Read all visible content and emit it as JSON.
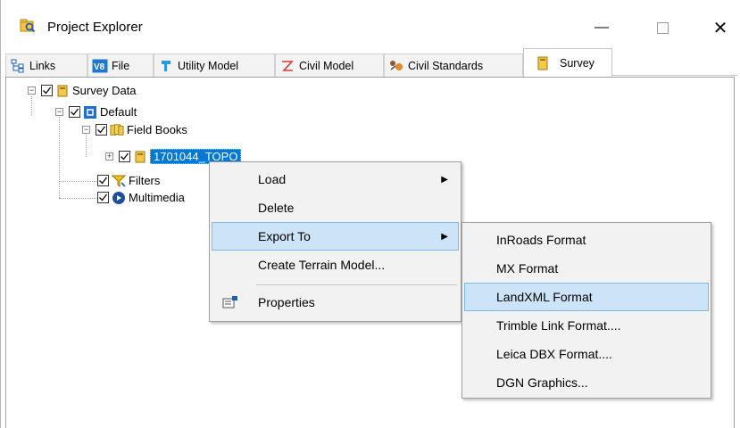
{
  "window": {
    "title": "Project Explorer"
  },
  "tabs": [
    {
      "label": "Links",
      "icon": "links-icon"
    },
    {
      "label": "File",
      "icon": "file-icon"
    },
    {
      "label": "Utility Model",
      "icon": "utility-model-icon"
    },
    {
      "label": "Civil Model",
      "icon": "civil-model-icon"
    },
    {
      "label": "Civil Standards",
      "icon": "civil-standards-icon"
    },
    {
      "label": "Survey",
      "icon": "survey-icon",
      "active": true
    }
  ],
  "tree": {
    "survey_data": "Survey Data",
    "default": "Default",
    "field_books": "Field Books",
    "topo": "1701044_TOPO",
    "filters": "Filters",
    "multimedia": "Multimedia"
  },
  "context_menu": {
    "items": [
      "Load",
      "Delete",
      "Export To",
      "Create Terrain Model...",
      "Properties"
    ],
    "highlighted": "Export To"
  },
  "export_submenu": {
    "items": [
      "InRoads Format",
      "MX Format",
      "LandXML Format",
      "Trimble Link Format....",
      "Leica DBX Format....",
      "DGN Graphics..."
    ],
    "highlighted": "LandXML Format"
  },
  "colors": {
    "selection": "#0078d7",
    "menu_highlight": "#cce4f7",
    "menu_bg": "#f2f2f2"
  }
}
